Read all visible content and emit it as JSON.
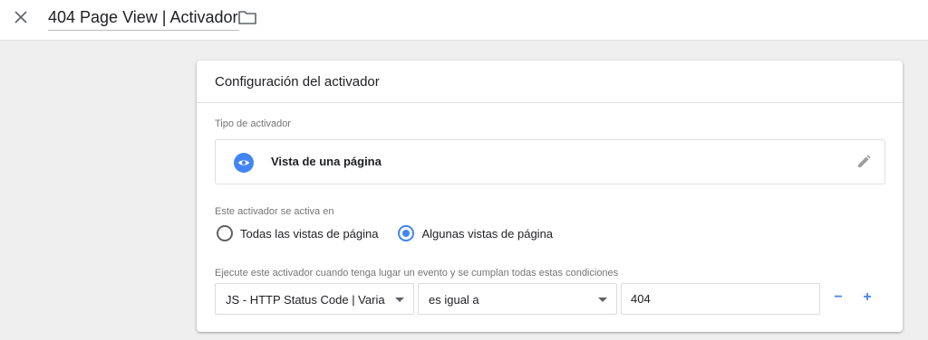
{
  "header": {
    "title": "404 Page View | Activador",
    "close_icon": "close-icon",
    "folder_icon": "folder-icon"
  },
  "card": {
    "title": "Configuración del activador",
    "trigger_type_label": "Tipo de activador",
    "trigger_type": {
      "name": "Vista de una página",
      "icon": "eye-icon",
      "icon_color": "#4285f4",
      "edit_icon": "pencil-icon"
    },
    "fires_on_label": "Este activador se activa en",
    "fires_on_options": [
      {
        "label": "Todas las vistas de página",
        "checked": false
      },
      {
        "label": "Algunas vistas de página",
        "checked": true
      }
    ],
    "condition_label": "Ejecute este activador cuando tenga lugar un evento y se cumplan todas estas condiciones",
    "condition": {
      "variable": "JS - HTTP Status Code | Variab",
      "operator": "es igual a",
      "value": "404",
      "remove_label": "−",
      "add_label": "+"
    }
  },
  "colors": {
    "accent": "#4285f4",
    "background": "#efefef",
    "card": "#ffffff"
  }
}
